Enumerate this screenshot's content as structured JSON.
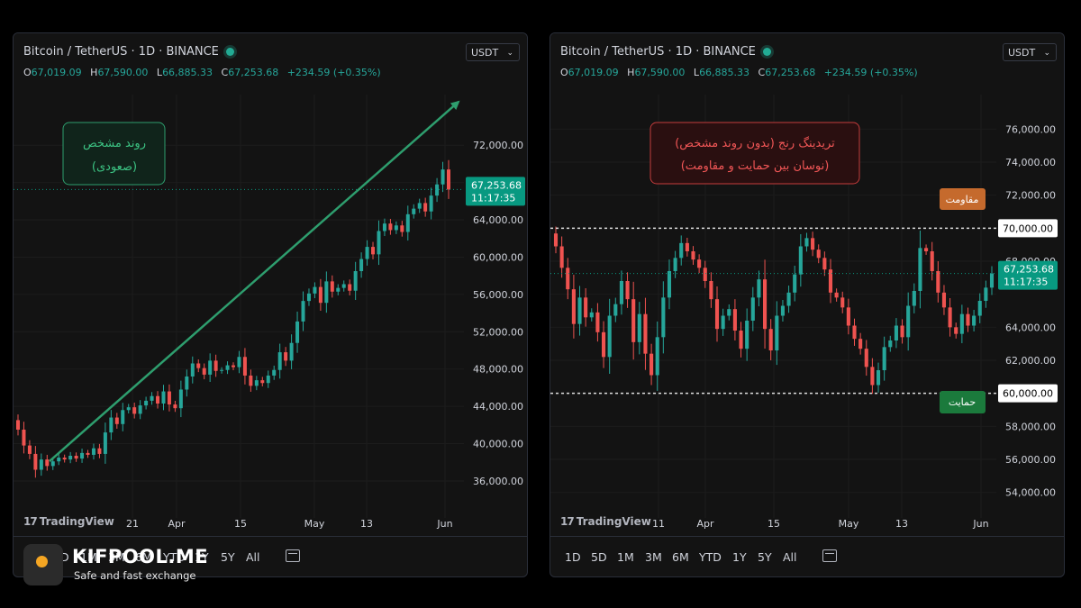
{
  "panels": [
    {
      "title": "Bitcoin / TetherUS · 1D · BINANCE",
      "currency": "USDT",
      "ohlc": {
        "o_label": "O",
        "o": "67,019.09",
        "h_label": "H",
        "h": "67,590.00",
        "l_label": "L",
        "l": "66,885.33",
        "c_label": "C",
        "c": "67,253.68",
        "change": "+234.59 (+0.35%)"
      },
      "watermark": "TradingView",
      "timeframes": [
        "1D",
        "5D",
        "1M",
        "3M",
        "6M",
        "YTD",
        "1Y",
        "5Y",
        "All"
      ],
      "price_tag": {
        "value": "67,253.68",
        "countdown": "11:17:35"
      },
      "annotation": {
        "line1": "روند مشخص",
        "line2": "(صعودی)"
      }
    },
    {
      "title": "Bitcoin / TetherUS · 1D · BINANCE",
      "currency": "USDT",
      "ohlc": {
        "o_label": "O",
        "o": "67,019.09",
        "h_label": "H",
        "h": "67,590.00",
        "l_label": "L",
        "l": "66,885.33",
        "c_label": "C",
        "c": "67,253.68",
        "change": "+234.59 (+0.35%)"
      },
      "watermark": "TradingView",
      "timeframes": [
        "1D",
        "5D",
        "1M",
        "3M",
        "6M",
        "YTD",
        "1Y",
        "5Y",
        "All"
      ],
      "price_tag": {
        "value": "67,253.68",
        "countdown": "11:17:35"
      },
      "annotation": {
        "line1": "تریدینگ رنج (بدون روند مشخص)",
        "line2": "(نوسان بین حمایت و مقاومت)"
      },
      "resistance": {
        "label": "مقاومت",
        "price_label": "70,000.00",
        "value": 70000
      },
      "support": {
        "label": "حمایت",
        "price_label": "60,000.00",
        "value": 60000
      }
    }
  ],
  "brand": {
    "name": "KIFPOOL.ME",
    "tagline": "Safe and fast exchange"
  },
  "colors": {
    "up": "#26a69a",
    "down": "#ef5350",
    "bg": "#131313",
    "grid": "#1c1c1c",
    "trend_arrow": "#2e9e6e",
    "resistance_badge": "#c56a2d",
    "support_badge": "#1b7a3c",
    "price_tag": "#089981"
  },
  "chart_data": [
    {
      "type": "candlestick",
      "title": "Bitcoin / TetherUS · 1D · BINANCE",
      "ylim": [
        33000,
        75500
      ],
      "y_ticks": [
        36000,
        40000,
        44000,
        48000,
        52000,
        56000,
        60000,
        64000,
        68000,
        72000
      ],
      "y_tick_labels": [
        "36,000.00",
        "40,000.00",
        "44,000.00",
        "48,000.00",
        "52,000.00",
        "56,000.00",
        "60,000.00",
        "64,000.00",
        "",
        "72,000.00"
      ],
      "x_tick_labels": [
        "21",
        "Apr",
        "15",
        "May",
        "13",
        "Jun"
      ],
      "last_price": 67253.68,
      "closes": [
        41500,
        39800,
        38900,
        37200,
        38300,
        37600,
        38100,
        38500,
        38300,
        38700,
        38400,
        39000,
        38800,
        39500,
        38900,
        41200,
        42800,
        42100,
        43600,
        43900,
        43200,
        44100,
        44600,
        45100,
        44300,
        45600,
        44200,
        43800,
        45800,
        47200,
        48600,
        48100,
        47400,
        48900,
        47800,
        47900,
        48400,
        48200,
        49300,
        47300,
        46200,
        46800,
        46500,
        47300,
        47900,
        49800,
        48900,
        50800,
        53100,
        55300,
        56100,
        56800,
        55100,
        57400,
        56300,
        56700,
        57100,
        56400,
        58500,
        59800,
        61100,
        60300,
        62800,
        63600,
        62900,
        63400,
        62700,
        64600,
        65200,
        65800,
        64900,
        66600,
        67800,
        69400,
        67250
      ]
    },
    {
      "type": "candlestick",
      "title": "Bitcoin / TetherUS · 1D · BINANCE",
      "ylim": [
        53000,
        77000
      ],
      "y_ticks": [
        54000,
        56000,
        58000,
        60000,
        62000,
        64000,
        66000,
        68000,
        70000,
        72000,
        74000,
        76000
      ],
      "y_tick_labels": [
        "54,000.00",
        "56,000.00",
        "58,000.00",
        "",
        "62,000.00",
        "64,000.00",
        "",
        "68,000.00",
        "",
        "72,000.00",
        "74,000.00",
        "76,000.00"
      ],
      "x_tick_labels": [
        "11",
        "Apr",
        "15",
        "May",
        "13",
        "Jun"
      ],
      "last_price": 67253.68,
      "closes": [
        68900,
        67600,
        66300,
        64200,
        65800,
        64600,
        64900,
        63700,
        62200,
        64700,
        65400,
        66800,
        65700,
        63100,
        64800,
        62400,
        61100,
        63400,
        65800,
        67400,
        68200,
        69100,
        68600,
        68100,
        67600,
        66800,
        65700,
        63900,
        64700,
        65100,
        63800,
        62700,
        64400,
        65800,
        66900,
        63900,
        62600,
        64700,
        65300,
        66100,
        67200,
        68900,
        69400,
        68700,
        68200,
        67500,
        66100,
        65800,
        65200,
        64100,
        63300,
        62700,
        61600,
        60500,
        61400,
        62800,
        63200,
        64100,
        63400,
        65300,
        66200,
        68800,
        68600,
        67400,
        66100,
        65200,
        64000,
        63600,
        64800,
        64100,
        64700,
        65600,
        66400,
        67254
      ]
    }
  ]
}
